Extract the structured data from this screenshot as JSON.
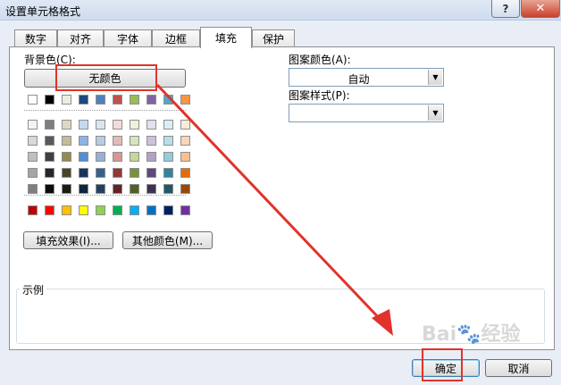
{
  "window": {
    "title": "设置单元格格式",
    "help": "?",
    "close": "✕"
  },
  "tabs": [
    "数字",
    "对齐",
    "字体",
    "边框",
    "填充",
    "保护"
  ],
  "active_tab": "填充",
  "background": {
    "label": "背景色(C):",
    "no_color": "无颜色",
    "row1": [
      "#ffffff",
      "#000000",
      "#eeece1",
      "#1f497d",
      "#4f81bd",
      "#c0504d",
      "#9bbb59",
      "#8064a2",
      "#4bacc6",
      "#f79646"
    ],
    "grid": [
      [
        "#f2f2f2",
        "#7f7f7f",
        "#ddd9c3",
        "#c6d9f0",
        "#dbe5f1",
        "#f2dcdb",
        "#ebf1dd",
        "#e5e0ec",
        "#dbeef3",
        "#fdeada"
      ],
      [
        "#d8d8d8",
        "#595959",
        "#c4bd97",
        "#8db3e2",
        "#b8cce4",
        "#e5b9b7",
        "#d7e3bc",
        "#ccc1d9",
        "#b7dde8",
        "#fbd5b5"
      ],
      [
        "#bfbfbf",
        "#3f3f3f",
        "#938953",
        "#548dd4",
        "#95b3d7",
        "#d99694",
        "#c3d69b",
        "#b2a2c7",
        "#92cddc",
        "#fac08f"
      ],
      [
        "#a5a5a5",
        "#262626",
        "#494429",
        "#17365d",
        "#366092",
        "#953734",
        "#76923c",
        "#5f497a",
        "#31859b",
        "#e36c09"
      ],
      [
        "#7f7f7f",
        "#0c0c0c",
        "#1d1b10",
        "#0f243e",
        "#244061",
        "#632423",
        "#4f6128",
        "#3f3151",
        "#205867",
        "#974806"
      ]
    ],
    "standard": [
      "#c00000",
      "#ff0000",
      "#ffc000",
      "#ffff00",
      "#92d050",
      "#00b050",
      "#00b0f0",
      "#0070c0",
      "#002060",
      "#7030a0"
    ],
    "fill_effects": "填充效果(I)...",
    "more_colors": "其他颜色(M)..."
  },
  "pattern": {
    "color_label": "图案颜色(A):",
    "color_value": "自动",
    "style_label": "图案样式(P):",
    "style_value": ""
  },
  "sample": {
    "label": "示例"
  },
  "footer": {
    "ok": "确定",
    "cancel": "取消"
  },
  "annotation_color": "#e1332b"
}
